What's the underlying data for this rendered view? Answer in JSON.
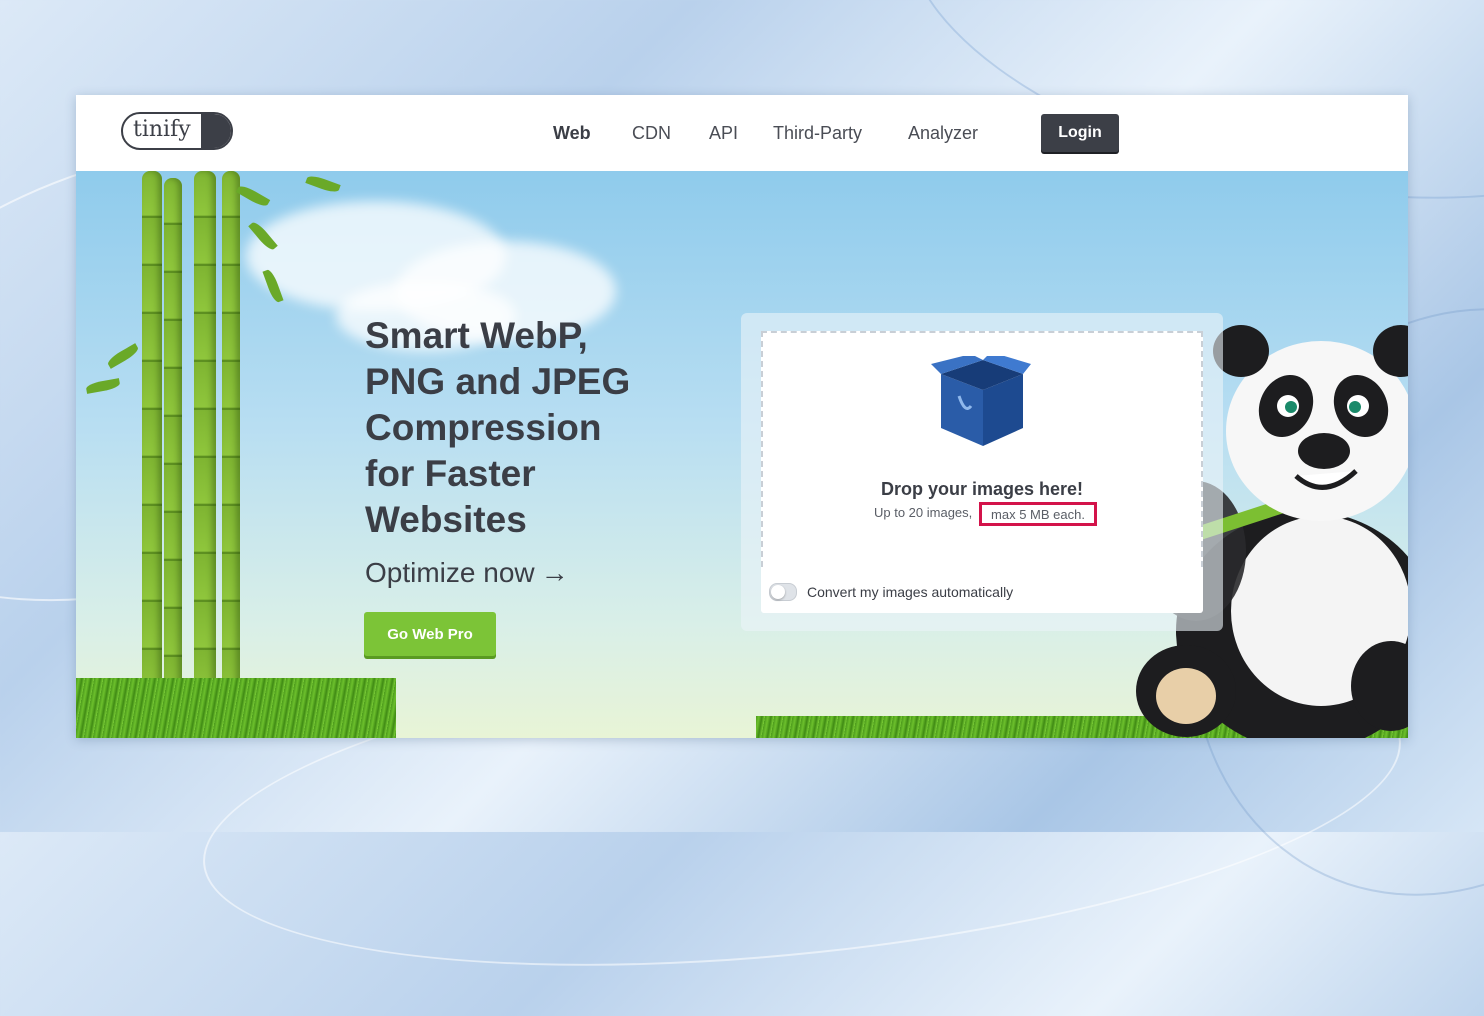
{
  "brand": {
    "logo_text": "tinify"
  },
  "nav": {
    "items": [
      {
        "label": "Web",
        "active": true
      },
      {
        "label": "CDN",
        "active": false
      },
      {
        "label": "API",
        "active": false
      },
      {
        "label": "Third-Party",
        "active": false
      },
      {
        "label": "Analyzer",
        "active": false
      }
    ],
    "login_label": "Login"
  },
  "hero": {
    "headline_lines": [
      "Smart WebP,",
      "PNG and JPEG",
      "Compression",
      "for Faster",
      "Websites"
    ],
    "optimize_label": "Optimize now",
    "optimize_arrow": "→",
    "cta_label": "Go Web Pro"
  },
  "uploader": {
    "icon": "box-icon",
    "title": "Drop your images here!",
    "subtitle": "Up to 20 images,",
    "limit": "max 5 MB each.",
    "limit_highlight_color": "#d3134a",
    "convert_label": "Convert my images automatically",
    "convert_enabled": false
  },
  "colors": {
    "primary_dark": "#3c3f47",
    "cta_green": "#7cc437"
  }
}
